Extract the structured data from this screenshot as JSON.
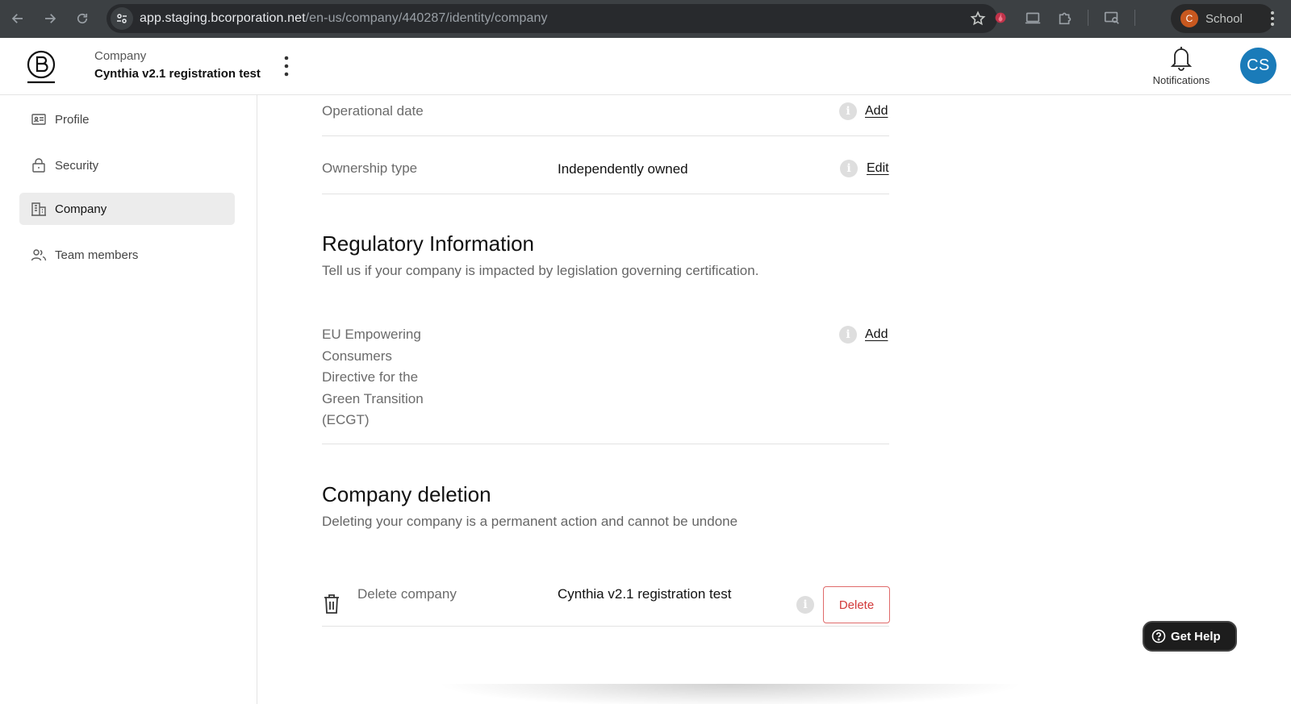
{
  "browser": {
    "url_host": "app.staging.bcorporation.net",
    "url_path": "/en-us/company/440287/identity/company",
    "profile_initial": "C",
    "profile_name": "School",
    "colors": {
      "chrome": "#3c4043",
      "omnibox": "#282a2d",
      "profile": "#c8581f"
    }
  },
  "header": {
    "company_label": "Company",
    "company_name": "Cynthia v2.1 registration test",
    "notifications_label": "Notifications",
    "avatar_initials": "CS",
    "colors": {
      "avatar": "#1a7bb9"
    }
  },
  "sidebar": {
    "items": [
      {
        "label": "Profile",
        "icon": "id-card-icon",
        "active": false
      },
      {
        "label": "Security",
        "icon": "lock-icon",
        "active": false
      },
      {
        "label": "Company",
        "icon": "building-icon",
        "active": true
      },
      {
        "label": "Team members",
        "icon": "users-icon",
        "active": false
      }
    ]
  },
  "main": {
    "fields": [
      {
        "label": "Operational date",
        "value": "",
        "action": "Add"
      },
      {
        "label": "Ownership type",
        "value": "Independently owned",
        "action": "Edit"
      }
    ],
    "regulatory": {
      "title": "Regulatory Information",
      "subtitle": "Tell us if your company is impacted by legislation governing certification.",
      "field_label_lines": [
        "EU Empowering",
        "Consumers",
        "Directive for the",
        "Green Transition",
        "(ECGT)"
      ],
      "action": "Add"
    },
    "deletion": {
      "title": "Company deletion",
      "subtitle": "Deleting your company is a permanent action and cannot be undone",
      "field_label": "Delete company",
      "field_value": "Cynthia v2.1 registration test",
      "button_label": "Delete",
      "colors": {
        "danger": "#d23a3a"
      }
    }
  },
  "help": {
    "label": "Get Help"
  }
}
